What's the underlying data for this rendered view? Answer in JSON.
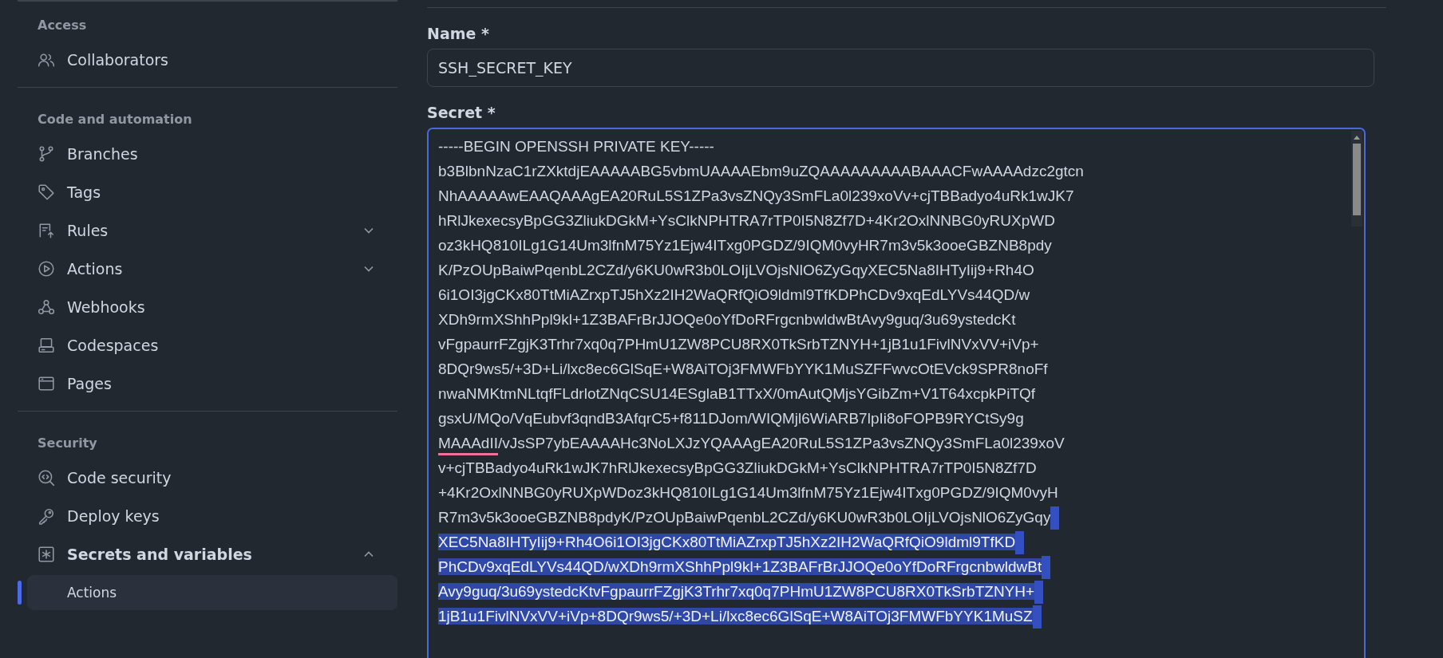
{
  "sidebar": {
    "sections": [
      {
        "title": "Access",
        "items": [
          {
            "label": "Collaborators"
          }
        ]
      },
      {
        "title": "Code and automation",
        "items": [
          {
            "label": "Branches"
          },
          {
            "label": "Tags"
          },
          {
            "label": "Rules",
            "expanded": false
          },
          {
            "label": "Actions",
            "expanded": false
          },
          {
            "label": "Webhooks"
          },
          {
            "label": "Codespaces"
          },
          {
            "label": "Pages"
          }
        ]
      },
      {
        "title": "Security",
        "items": [
          {
            "label": "Code security"
          },
          {
            "label": "Deploy keys"
          },
          {
            "label": "Secrets and variables",
            "expanded": true,
            "children": [
              {
                "label": "Actions",
                "selected": true
              }
            ]
          }
        ]
      }
    ]
  },
  "form": {
    "name_label": "Name *",
    "name_value": "SSH_SECRET_KEY",
    "secret_label": "Secret *",
    "secret_lines": [
      {
        "parts": [
          {
            "text": "-----BEGIN OPENSSH PRIVATE KEY-----",
            "misspelled": false
          }
        ],
        "selected": false,
        "eol_selected": false
      },
      {
        "parts": [
          {
            "text": "b3BlbnNzaC1rZXktdjEAAAAABG5vbmUAAAAEbm9uZQAAAAAAAAABAAACFwAAAAdzc2gtcn",
            "misspelled": false
          }
        ],
        "selected": false,
        "eol_selected": false
      },
      {
        "parts": [
          {
            "text": "NhAAAAAwEAAQAAAgEA20RuL5S1ZPa3vsZNQy3SmFLa0l239xoVv+cjTBBadyo4uRk1wJK7",
            "misspelled": false
          }
        ],
        "selected": false,
        "eol_selected": false
      },
      {
        "parts": [
          {
            "text": "hRlJkexecsyBpGG3ZliukDGkM+YsClkNPHTRA7rTP0I5N8Zf7D+4Kr2OxlNNBG0yRUXpWD",
            "misspelled": false
          }
        ],
        "selected": false,
        "eol_selected": false
      },
      {
        "parts": [
          {
            "text": "oz3kHQ810ILg1G14Um3lfnM75Yz1Ejw4ITxg0PGDZ/9IQM0vyHR7m3v5k3ooeGBZNB8pdy",
            "misspelled": false
          }
        ],
        "selected": false,
        "eol_selected": false
      },
      {
        "parts": [
          {
            "text": "K/PzOUpBaiwPqenbL2CZd/y6KU0wR3b0LOIjLVOjsNlO6ZyGqyXEC5Na8IHTyIij9+Rh4O",
            "misspelled": false
          }
        ],
        "selected": false,
        "eol_selected": false
      },
      {
        "parts": [
          {
            "text": "6i1OI3jgCKx80TtMiAZrxpTJ5hXz2IH2WaQRfQiO9ldml9TfKDPhCDv9xqEdLYVs44QD/w",
            "misspelled": false
          }
        ],
        "selected": false,
        "eol_selected": false
      },
      {
        "parts": [
          {
            "text": "XDh9rmXShhPpl9kl+1Z3BAFrBrJJOQe0oYfDoRFrgcnbwldwBtAvy9guq/3u69ystedcKt",
            "misspelled": false
          }
        ],
        "selected": false,
        "eol_selected": false
      },
      {
        "parts": [
          {
            "text": "vFgpaurrFZgjK3Trhr7xq0q7PHmU1ZW8PCU8RX0TkSrbTZNYH+1jB1u1FivlNVxVV+iVp+",
            "misspelled": false
          }
        ],
        "selected": false,
        "eol_selected": false
      },
      {
        "parts": [
          {
            "text": "8DQr9ws5/+3D+Li/lxc8ec6GlSqE+W8AiTOj3FMWFbYYK1MuSZFFwvcOtEVck9SPR8noFf",
            "misspelled": false
          }
        ],
        "selected": false,
        "eol_selected": false
      },
      {
        "parts": [
          {
            "text": "nwaNMKtmNLtqfFLdrlotZNqCSU14ESglaB1TTxX/0mAutQMjsYGibZm+V1T64xcpkPiTQf",
            "misspelled": false
          }
        ],
        "selected": false,
        "eol_selected": false
      },
      {
        "parts": [
          {
            "text": "gsxU/MQo/VqEubvf3qndB3AfqrC5+f811DJom/WIQMjl6WiARB7lpIi8oFOPB9RYCtSy9g",
            "misspelled": false
          }
        ],
        "selected": false,
        "eol_selected": false
      },
      {
        "parts": [
          {
            "text": "MAAAdII",
            "misspelled": true
          },
          {
            "text": "/vJsSP7ybEAAAAHc3NoLXJzYQAAAgEA20RuL5S1ZPa3vsZNQy3SmFLa0l239xoV",
            "misspelled": false
          }
        ],
        "selected": false,
        "eol_selected": false
      },
      {
        "parts": [
          {
            "text": "v+cjTBBadyo4uRk1wJK7hRlJkexecsyBpGG3ZliukDGkM+YsClkNPHTRA7rTP0I5N8Zf7D",
            "misspelled": false
          }
        ],
        "selected": false,
        "eol_selected": false
      },
      {
        "parts": [
          {
            "text": "+4Kr2OxlNNBG0yRUXpWDoz3kHQ810ILg1G14Um3lfnM75Yz1Ejw4ITxg0PGDZ/9IQM0vyH",
            "misspelled": false
          }
        ],
        "selected": false,
        "eol_selected": false
      },
      {
        "parts": [
          {
            "text": "R7m3v5k3ooeGBZNB8pdyK/PzOUpBaiwPqenbL2CZd/y6KU0wR3b0LOIjLVOjsNlO6ZyGqy",
            "misspelled": false
          }
        ],
        "selected": false,
        "eol_selected": true
      },
      {
        "parts": [
          {
            "text": "XEC5Na8IHTyIij9+Rh4O6i1OI3jgCKx80TtMiAZrxpTJ5hXz2IH2WaQRfQiO9ldml9TfKD",
            "misspelled": false
          }
        ],
        "selected": true,
        "eol_selected": true
      },
      {
        "parts": [
          {
            "text": "PhCDv9xqEdLYVs44QD/wXDh9rmXShhPpl9kl+1Z3BAFrBrJJOQe0oYfDoRFrgcnbwldwBt",
            "misspelled": false
          }
        ],
        "selected": true,
        "eol_selected": true
      },
      {
        "parts": [
          {
            "text": "Avy9guq/3u69ystedcKtvFgpaurrFZgjK3Trhr7xq0q7PHmU1ZW8PCU8RX0TkSrbTZNYH+",
            "misspelled": false
          }
        ],
        "selected": true,
        "eol_selected": true
      },
      {
        "parts": [
          {
            "text": "1jB1u1FivlNVxVV+iVp+8DQr9ws5/+3D+Li/lxc8ec6GlSqE+W8AiTOj3FMWFbYYK1MuSZ",
            "misspelled": false
          }
        ],
        "selected": true,
        "eol_selected": true
      }
    ]
  }
}
